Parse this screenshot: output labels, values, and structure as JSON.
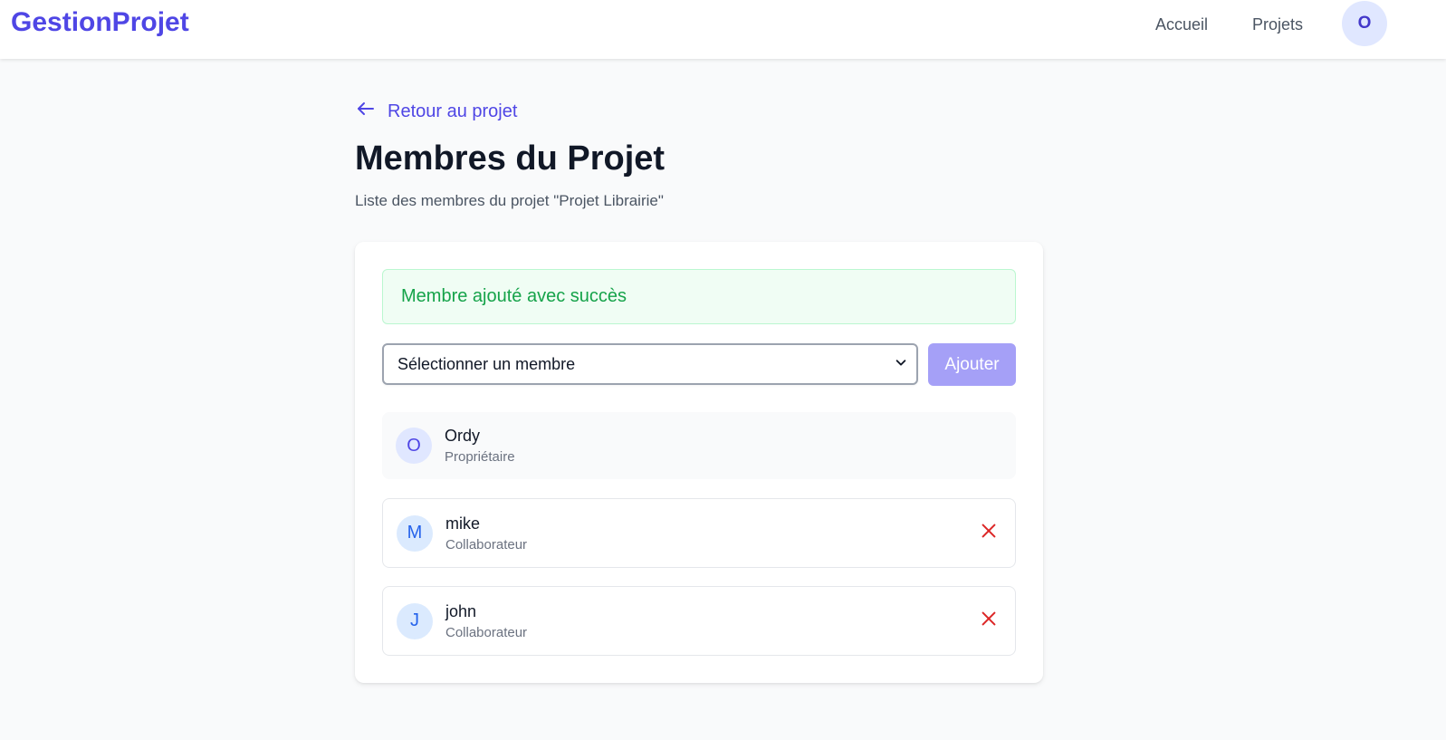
{
  "header": {
    "brand": "GestionProjet",
    "nav": {
      "accueil": "Accueil",
      "projets": "Projets"
    },
    "user_initial": "O"
  },
  "back_link": {
    "label": "Retour au projet",
    "icon": "arrow-left-icon"
  },
  "page": {
    "title": "Membres du Projet",
    "subtitle": "Liste des membres du projet \"Projet Librairie\""
  },
  "alert": {
    "message": "Membre ajouté avec succès"
  },
  "add_member": {
    "select_value": "Sélectionner un membre",
    "button_label": "Ajouter"
  },
  "members": [
    {
      "initial": "O",
      "name": "Ordy",
      "role": "Propriétaire",
      "removable": false
    },
    {
      "initial": "M",
      "name": "mike",
      "role": "Collaborateur",
      "removable": true
    },
    {
      "initial": "J",
      "name": "john",
      "role": "Collaborateur",
      "removable": true
    }
  ],
  "colors": {
    "primary": "#4f46e5",
    "success_bg": "#f0fdf4",
    "success_text": "#16a34a",
    "danger": "#dc2626",
    "button_disabled": "#a5a0f7"
  }
}
